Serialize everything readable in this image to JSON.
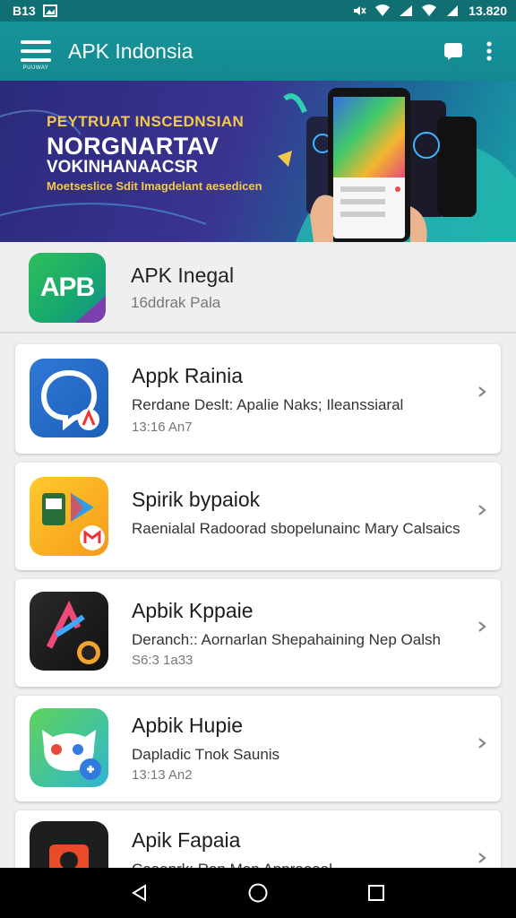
{
  "status_bar": {
    "left_text": "B13",
    "time": "13.820"
  },
  "app_bar": {
    "menu_caption": "PUUWAY",
    "title": "APK Indonsia"
  },
  "banner": {
    "kicker": "PEYTRUAT INSCEDNSIAN",
    "title_line1": "NORGNARTAV",
    "title_line2": "VOKINHANAACSR",
    "tagline": "Moetseslice Sdit Imagdelant aesedicen"
  },
  "featured": {
    "logo_text": "APB",
    "name": "APK Inegal",
    "subtitle": "16ddrak Pala"
  },
  "apps": [
    {
      "title": "Appk Rainia",
      "description": "Rerdane Deslt: Apalie Naks; Ileanssiaral",
      "meta": "13:16 An7",
      "icon": "chat-bubble-icon"
    },
    {
      "title": "Spirik bypaiok",
      "description": "Raenialal Radoorad sbopelunainc Mary Calsaics",
      "meta": "",
      "icon": "play-store-icon"
    },
    {
      "title": "Apbik Kppaie",
      "description": "Deranch:: Aornarlan Shepahaining Nep Oalsh",
      "meta": "S6:3 1a33",
      "icon": "music-app-icon"
    },
    {
      "title": "Apbik Hupie",
      "description": "Dapladic Tnok Saunis",
      "meta": "13:13 An2",
      "icon": "cat-face-icon"
    },
    {
      "title": "Apik Fapaia",
      "description": "Coaenrk: Ran Map Appraoaal",
      "meta": "",
      "icon": "camera-app-icon"
    }
  ],
  "colors": {
    "primary": "#17949a",
    "status_bar": "#0f6f73",
    "banner_accent": "#f4c94a"
  }
}
